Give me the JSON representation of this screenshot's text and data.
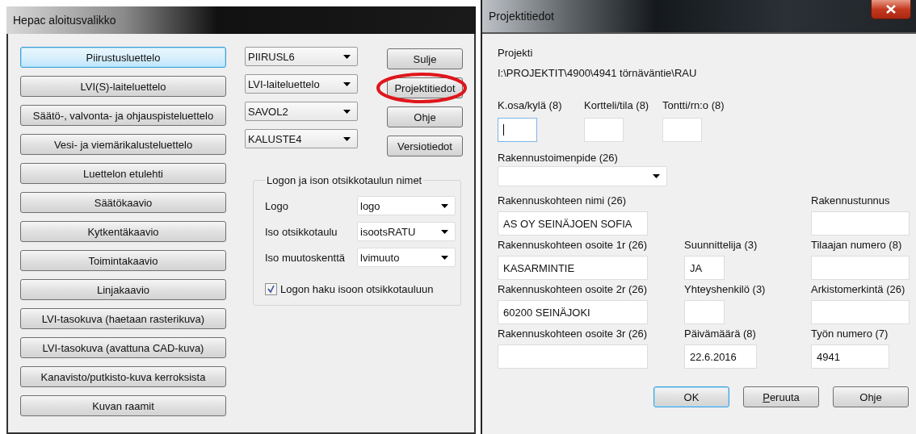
{
  "left_window": {
    "title": "Hepac aloitusvalikko",
    "list_buttons": [
      {
        "label": "Piirustusluettelo",
        "focused": true
      },
      {
        "label": "LVI(S)-laiteluettelo",
        "focused": false
      },
      {
        "label": "Säätö-, valvonta- ja ohjauspisteluettelo",
        "focused": false
      },
      {
        "label": "Vesi- ja viemärikalusteluettelo",
        "focused": false
      },
      {
        "label": "Luettelon etulehti",
        "focused": false
      },
      {
        "label": "Säätökaavio",
        "focused": false
      },
      {
        "label": "Kytkentäkaavio",
        "focused": false
      },
      {
        "label": "Toimintakaavio",
        "focused": false
      },
      {
        "label": "Linjakaavio",
        "focused": false
      },
      {
        "label": "LVI-tasokuva (haetaan rasterikuva)",
        "focused": false
      },
      {
        "label": "LVI-tasokuva (avattuna CAD-kuva)",
        "focused": false
      },
      {
        "label": "Kanavisto/putkisto-kuva kerroksista",
        "focused": false
      },
      {
        "label": "Kuvan raamit",
        "focused": false
      }
    ],
    "dropdowns": [
      {
        "value": "PIIRUSL6"
      },
      {
        "value": "LVI-laiteluettelo"
      },
      {
        "value": "SAVOL2"
      },
      {
        "value": "KALUSTE4"
      }
    ],
    "action_buttons": [
      {
        "label": "Sulje",
        "circled": false
      },
      {
        "label": "Projektitiedot",
        "circled": true
      },
      {
        "label": "Ohje",
        "circled": false
      },
      {
        "label": "Versiotiedot",
        "circled": false
      }
    ],
    "group": {
      "title": "Logon ja ison otsikkotaulun nimet",
      "rows": [
        {
          "label": "Logo",
          "value": "logo"
        },
        {
          "label": "Iso otsikkotaulu",
          "value": "isootsRATU"
        },
        {
          "label": "Iso muutoskenttä",
          "value": "lvimuuto"
        }
      ],
      "checkbox": {
        "label": "Logon haku isoon otsikkotauluun",
        "checked": true
      }
    }
  },
  "right_window": {
    "title": "Projektitiedot",
    "project_label": "Projekti",
    "project_path": "I:\\PROJEKTIT\\4900\\4941 törnäväntie\\RAU",
    "plot_fields": [
      {
        "label": "K.osa/kylä (8)",
        "focused": true
      },
      {
        "label": "Kortteli/tila (8)",
        "focused": false
      },
      {
        "label": "Tontti/rn:o (8)",
        "focused": false
      }
    ],
    "operation": {
      "label": "Rakennustoimenpide (26)"
    },
    "fields": [
      {
        "label": "Rakennuskohteen nimi (26)",
        "value": "AS OY SEINÄJOEN SOFIA"
      },
      {
        "label": "Rakennustunnus"
      },
      {
        "label": "Rakennuskohteen osoite 1r (26)",
        "value": "KASARMINTIE"
      },
      {
        "label": "Suunnittelija (3)",
        "value": "JA"
      },
      {
        "label": "Tilaajan numero (8)"
      },
      {
        "label": "Rakennuskohteen osoite 2r (26)",
        "value": "60200 SEINÄJOKI"
      },
      {
        "label": "Yhteyshenkilö (3)"
      },
      {
        "label": "Arkistomerkintä (26)"
      },
      {
        "label": "Rakennuskohteen osoite 3r (26)"
      },
      {
        "label": "Päivämäärä (8)",
        "value": "22.6.2016"
      },
      {
        "label": "Työn numero (7)",
        "value": "4941"
      }
    ],
    "buttons": [
      {
        "label": "OK",
        "default": true
      },
      {
        "label": "Peruuta",
        "default": false
      },
      {
        "label": "Ohje",
        "default": false
      }
    ]
  }
}
